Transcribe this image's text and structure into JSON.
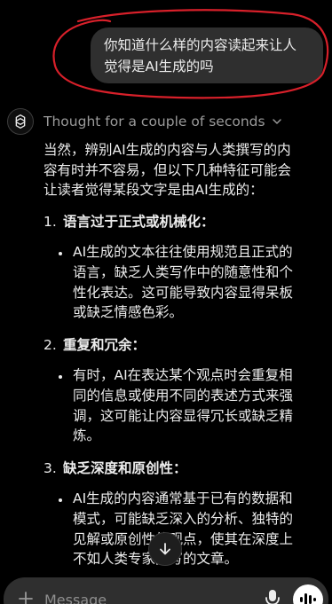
{
  "user_message": {
    "lines": [
      "你知道什么样的内容读起来让人",
      "觉得是AI生成的吗"
    ],
    "annotation_color": "#d8202a"
  },
  "assistant": {
    "avatar_icon": "chatgpt-logo-icon",
    "thought_label": "Thought for a couple of seconds",
    "thought_icon": "chevron-down-icon",
    "intro_lines": [
      "当然，辨别AI生成的内容与人类撰写的内",
      "容有时并不容易，但以下几种特征可能会",
      "让读者觉得某段文字是由AI生成的："
    ],
    "sections": [
      {
        "number": "1.",
        "title": "语言过于正式或机械化：",
        "bullet_lines": [
          "AI生成的文本往往使用规范且正式的",
          "语言，缺乏人类写作中的随意性和个",
          "性化表达。这可能导致内容显得呆板",
          "或缺乏情感色彩。"
        ]
      },
      {
        "number": "2.",
        "title": "重复和冗余：",
        "bullet_lines": [
          "有时，AI在表达某个观点时会重复相",
          "同的信息或使用不同的表述方式来强",
          "调，这可能让内容显得冗长或缺乏精",
          "炼。"
        ]
      },
      {
        "number": "3.",
        "title": "缺乏深度和原创性：",
        "bullet_lines": [
          "AI生成的内容通常基于已有的数据和",
          "模式，可能缺乏深入的分析、独特的",
          "见解或原创性的观点，使其在深度上",
          "不如人类专家撰写的文章。"
        ]
      }
    ]
  },
  "scroll_button_icon": "arrow-down-icon",
  "composer": {
    "placeholder": "Message",
    "plus_icon": "plus-icon",
    "mic_icon": "microphone-icon",
    "voice_icon": "voice-waveform-icon"
  }
}
